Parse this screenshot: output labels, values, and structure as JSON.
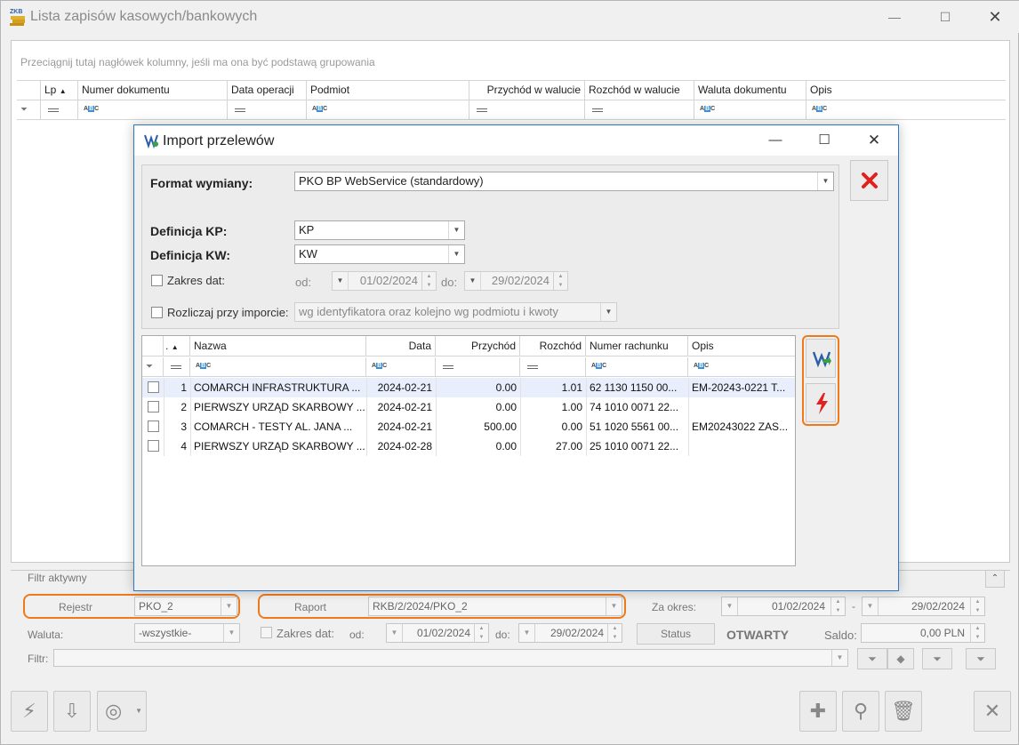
{
  "window": {
    "title": "Lista zapisów kasowych/bankowych",
    "logo_text": "ZKB"
  },
  "grid": {
    "group_hint": "Przeciągnij tutaj nagłówek kolumny, jeśli ma ona być podstawą grupowania",
    "columns": [
      "Lp",
      "Numer dokumentu",
      "Data operacji",
      "Podmiot",
      "Przychód w walucie",
      "Rozchód w walucie",
      "Waluta dokumentu",
      "Opis"
    ]
  },
  "dialog": {
    "title": "Import przelewów",
    "format_label": "Format wymiany:",
    "format_value": "PKO BP WebService  (standardowy)",
    "kp_label": "Definicja KP:",
    "kp_value": "KP",
    "kw_label": "Definicja KW:",
    "kw_value": "KW",
    "date_range_label": "Zakres dat:",
    "from_label": "od:",
    "from_value": "01/02/2024",
    "to_label": "do:",
    "to_value": "29/02/2024",
    "settle_label": "Rozliczaj przy imporcie:",
    "settle_value": "wg identyfikatora oraz kolejno wg podmiotu i kwoty",
    "columns": [
      ".",
      "Nazwa",
      "Data",
      "Przychód",
      "Rozchód",
      "Numer rachunku",
      "Opis"
    ],
    "rows": [
      {
        "lp": "1",
        "name": "COMARCH INFRASTRUKTURA ...",
        "date": "2024-02-21",
        "income": "0.00",
        "expense": "1.01",
        "account": "62 1130 1150 00...",
        "desc": "EM-20243-0221 T..."
      },
      {
        "lp": "2",
        "name": "PIERWSZY URZĄD SKARBOWY ...",
        "date": "2024-02-21",
        "income": "0.00",
        "expense": "1.00",
        "account": "74 1010 0071 22...",
        "desc": ""
      },
      {
        "lp": "3",
        "name": "COMARCH - TESTY  AL. JANA ...",
        "date": "2024-02-21",
        "income": "500.00",
        "expense": "0.00",
        "account": "51 1020 5561 00...",
        "desc": "EM20243022 ZAS..."
      },
      {
        "lp": "4",
        "name": "PIERWSZY URZĄD SKARBOWY ...",
        "date": "2024-02-28",
        "income": "0.00",
        "expense": "27.00",
        "account": "25 1010 0071 22...",
        "desc": ""
      }
    ]
  },
  "filter": {
    "active_label": "Filtr aktywny",
    "register_label": "Rejestr",
    "register_value": "PKO_2",
    "report_label": "Raport",
    "report_value": "RKB/2/2024/PKO_2",
    "period_label": "Za okres:",
    "period_from": "01/02/2024",
    "period_to": "29/02/2024",
    "currency_label": "Waluta:",
    "currency_value": "-wszystkie-",
    "date_range_label": "Zakres dat:",
    "from_label": "od:",
    "from_value": "01/02/2024",
    "to_label": "do:",
    "to_value": "29/02/2024",
    "status_button": "Status",
    "status_value": "OTWARTY",
    "balance_label": "Saldo:",
    "balance_value": "0,00 PLN",
    "filter_label": "Filtr:"
  },
  "colors": {
    "accent_orange": "#f07a1a",
    "dialog_border": "#2b78c5",
    "close_red": "#e0211d",
    "selected_row": "#e8eefb"
  }
}
